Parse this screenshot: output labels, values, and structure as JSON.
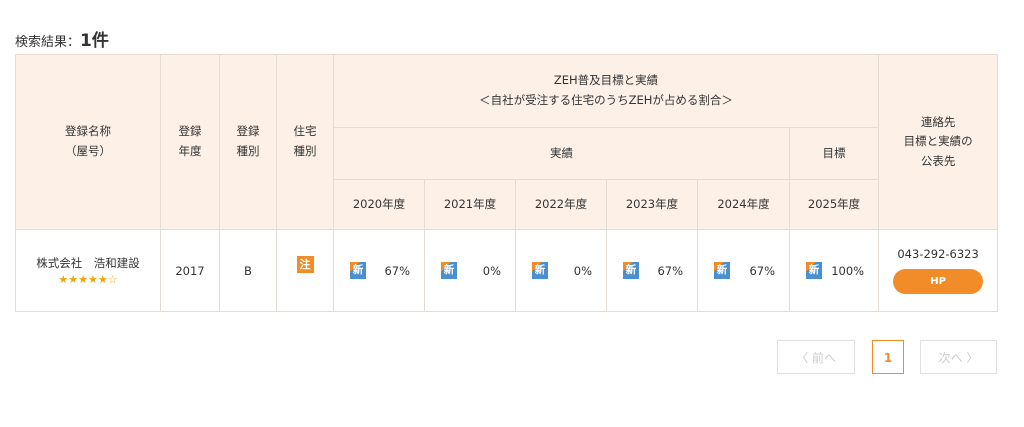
{
  "result": {
    "label": "検索結果：",
    "count": "1件"
  },
  "table": {
    "headers": {
      "name": "登録名称\n（屋号）",
      "year": "登録\n年度",
      "type": "登録\n種別",
      "house_type": "住宅\n種別",
      "zeh_title": "ZEH普及目標と実績\n＜自社が受注する住宅のうちZEHが占める割合＞",
      "contact": "連絡先\n目標と実績の\n公表先",
      "actual": "実績",
      "target": "目標",
      "years": [
        "2020年度",
        "2021年度",
        "2022年度",
        "2023年度",
        "2024年度",
        "2025年度"
      ]
    },
    "rows": [
      {
        "name": "株式会社　浩和建設",
        "stars": "★★★★★☆",
        "rating": "5 of 6 stars",
        "year": "2017",
        "type": "B",
        "house_tag": "注",
        "new_badge": "新",
        "values": [
          "67%",
          "0%",
          "0%",
          "67%",
          "67%",
          "100%"
        ],
        "phone": "043-292-6323",
        "hp": "HP"
      }
    ]
  },
  "pager": {
    "prev": "〈 前へ",
    "current": "1",
    "next": "次へ 〉"
  },
  "colors": {
    "accent": "#f28c28",
    "header_bg": "#fdf1e7",
    "border": "#e4dcd3",
    "badge_blue": "#4a8fd0",
    "star": "#f0a500"
  }
}
